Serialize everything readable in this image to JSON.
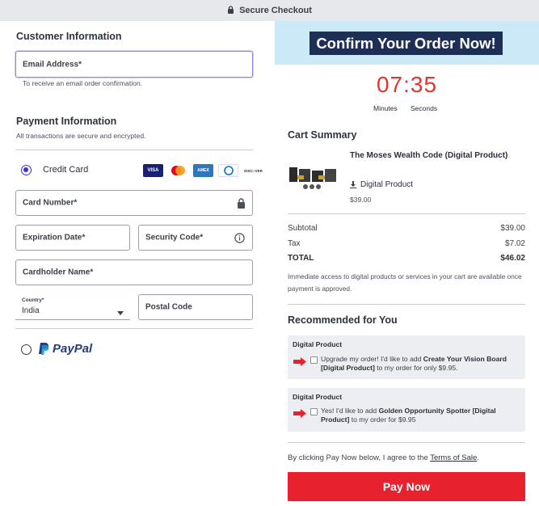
{
  "topbar": {
    "label": "Secure Checkout"
  },
  "customer": {
    "heading": "Customer Information",
    "email_label": "Email Address*",
    "email_help": "To receive an email order confirmation."
  },
  "payment": {
    "heading": "Payment Information",
    "subtext": "All transactions are secure and encrypted.",
    "credit_card_label": "Credit Card",
    "card_brands": [
      "VISA",
      "MC",
      "AMEX",
      "DINERS",
      "DISCOVER"
    ],
    "card_number_label": "Card Number*",
    "expiration_label": "Expiration Date*",
    "security_code_label": "Security Code*",
    "cardholder_label": "Cardholder Name*",
    "country_label": "Country*",
    "country_value": "India",
    "postal_label": "Postal Code",
    "paypal_label": "PayPal"
  },
  "banner": {
    "title": "Confirm Your Order Now!"
  },
  "timer": {
    "value": "07:35",
    "minutes_label": "Minutes",
    "seconds_label": "Seconds"
  },
  "cart": {
    "heading": "Cart Summary",
    "product_name": "The Moses Wealth Code (Digital Product)",
    "product_type": "Digital Product",
    "product_price": "$39.00",
    "subtotal_label": "Subtotal",
    "subtotal_value": "$39.00",
    "tax_label": "Tax",
    "tax_value": "$7.02",
    "total_label": "TOTAL",
    "total_value": "$46.02",
    "note": "Immediate access to digital products or services in your cart are available once payment is approved."
  },
  "recommended": {
    "heading": "Recommended for You",
    "items": [
      {
        "category": "Digital Product",
        "pre": "Upgrade my order! I'd like to add ",
        "bold": "Create Your Vision Board [Digital Product]",
        "post": " to my order for only $9.95."
      },
      {
        "category": "Digital Product",
        "pre": "Yes! I'd like to add ",
        "bold": "Golden Opportunity Spotter [Digital Product]",
        "post": " to my order for $9.95"
      }
    ]
  },
  "terms": {
    "pre": "By clicking Pay Now below, I agree to the ",
    "link": "Terms of Sale",
    "post": "."
  },
  "pay_button": {
    "label": "Pay Now"
  },
  "colors": {
    "accent": "#3b2fd6",
    "pay": "#e8212e",
    "timer": "#e3342f",
    "banner_bg": "#cce9f7",
    "banner_title_bg": "#1e2f56"
  },
  "icons": [
    "lock-icon",
    "info-icon",
    "chevron-down-icon",
    "download-icon",
    "arrow-right-icon"
  ]
}
